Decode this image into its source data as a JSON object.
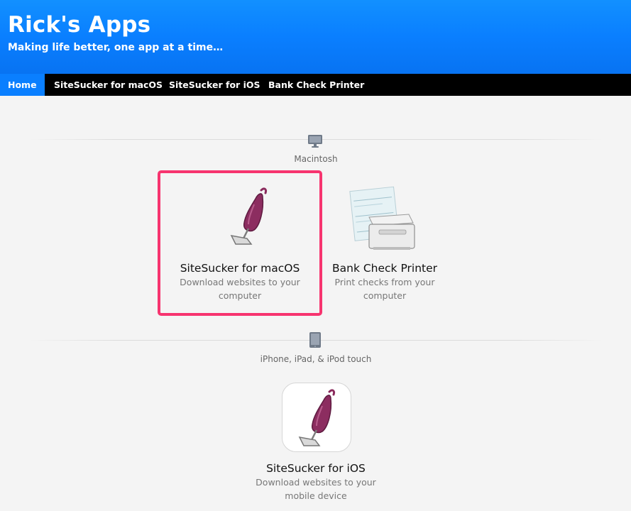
{
  "header": {
    "title": "Rick's Apps",
    "subtitle": "Making life better, one app at a time…"
  },
  "nav": {
    "items": [
      {
        "label": "Home",
        "active": true
      },
      {
        "label": "SiteSucker for macOS",
        "active": false
      },
      {
        "label": "SiteSucker for iOS",
        "active": false
      },
      {
        "label": "Bank Check Printer",
        "active": false
      }
    ]
  },
  "sections": [
    {
      "label": "Macintosh",
      "icon": "desktop-monitor-icon",
      "apps": [
        {
          "name": "SiteSucker for macOS",
          "description_lines": [
            "Download websites to your",
            "computer"
          ],
          "icon": "vacuum-cleaner-icon",
          "highlighted": true
        },
        {
          "name": "Bank Check Printer",
          "description_lines": [
            "Print checks from your",
            "computer"
          ],
          "icon": "check-printer-icon",
          "highlighted": false
        }
      ]
    },
    {
      "label": "iPhone, iPad, & iPod touch",
      "icon": "ipad-device-icon",
      "apps": [
        {
          "name": "SiteSucker for iOS",
          "description_lines": [
            "Download websites to your",
            "mobile device"
          ],
          "icon": "vacuum-cleaner-icon",
          "highlighted": false
        }
      ]
    }
  ],
  "colors": {
    "header_blue": "#0a7fff",
    "nav_black": "#000000",
    "highlight_pink": "#f7346f",
    "page_background": "#f4f4f4"
  }
}
